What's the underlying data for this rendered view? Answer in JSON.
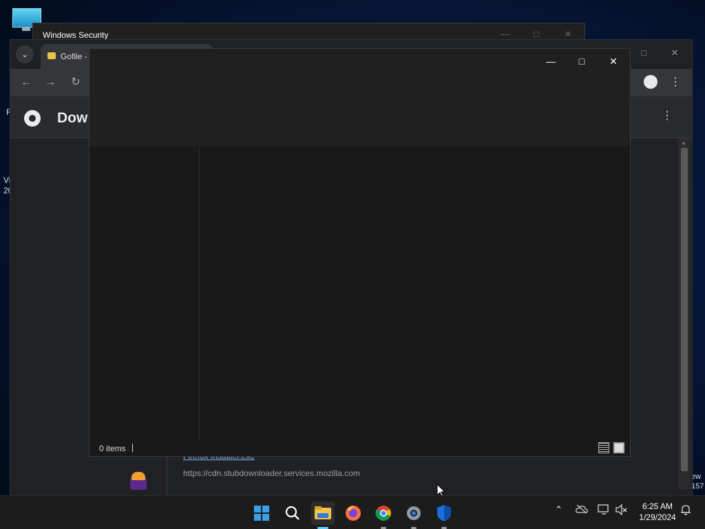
{
  "desktop": {
    "left_fragments": [
      "R",
      "Vi",
      "20"
    ],
    "right_fragments": [
      "ew",
      "157"
    ]
  },
  "windows_security": {
    "title": "Windows Security"
  },
  "chrome": {
    "tab_title": "Gofile -",
    "page_title": "Dow",
    "download_item": {
      "filename": "Firefox Installer.exe",
      "url": "https://cdn.stubdownloader.services.mozilla.com"
    }
  },
  "explorer": {
    "status_count": "0 items"
  },
  "taskbar": {
    "apps": [
      "start-icon",
      "search-icon",
      "file-explorer-icon",
      "firefox-icon",
      "chrome-icon",
      "settings-icon",
      "windows-security-icon"
    ],
    "time": "6:25 AM",
    "date": "1/29/2024"
  },
  "colors": {
    "accent": "#60cdff",
    "link": "#8ab4f8",
    "window_bg": "#191919"
  }
}
